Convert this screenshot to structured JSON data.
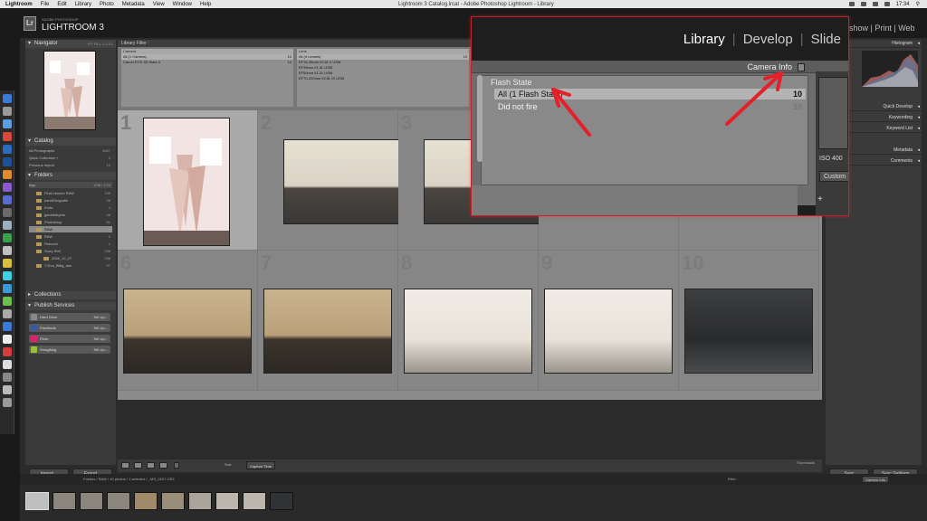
{
  "menubar": {
    "app": "Lightroom",
    "items": [
      "File",
      "Edit",
      "Library",
      "Photo",
      "Metadata",
      "View",
      "Window",
      "Help"
    ],
    "window_title": "Lightroom 3 Catalog.lrcat - Adobe Photoshop Lightroom - Library",
    "clock": "17:34"
  },
  "identity": {
    "logo": "Lr",
    "brand_small": "ADOBE PHOTOSHOP",
    "brand": "LIGHTROOM 3"
  },
  "left": {
    "navigator": {
      "title": "Navigator",
      "zooms": "FIT  FILL  1:1  4:1"
    },
    "catalog": {
      "title": "Catalog",
      "items": [
        {
          "label": "All Photographs",
          "count": "4657"
        },
        {
          "label": "Quick Collection +",
          "count": "0"
        },
        {
          "label": "Previous Import",
          "count": "10"
        }
      ]
    },
    "folders": {
      "title": "Folders",
      "volume": "bigs",
      "volume_info": "1MB / 1TB",
      "items": [
        {
          "label": "Final chosen RAW",
          "count": "135"
        },
        {
          "label": "handStorgrafie",
          "count": "26"
        },
        {
          "label": "Extra",
          "count": "4"
        },
        {
          "label": "jpeddeltryres",
          "count": "46"
        },
        {
          "label": "Photoshop",
          "count": "81"
        },
        {
          "label": "RAW",
          "count": "10"
        },
        {
          "label": "RAW",
          "count": "0"
        },
        {
          "label": "Retouch",
          "count": "1"
        },
        {
          "label": "Sorry Stef",
          "count": "236"
        },
        {
          "label": "2009_12_27",
          "count": "236"
        },
        {
          "label": "T-Dva_Billig_raw",
          "count": "97"
        }
      ]
    },
    "collections": {
      "title": "Collections"
    },
    "publish": {
      "title": "Publish Services",
      "services": [
        {
          "label": "Hard Drive",
          "action": "Set Up..."
        },
        {
          "label": "Facebook",
          "action": "Set Up..."
        },
        {
          "label": "Flickr",
          "action": "Set Up..."
        },
        {
          "label": "SmugMug",
          "action": "Set Up..."
        }
      ]
    },
    "import_btn": "Import...",
    "export_btn": "Export..."
  },
  "filterbar": {
    "title": "Library Filter :",
    "col1": {
      "head": "Camera",
      "items": [
        {
          "label": "All (1 Camera)",
          "count": "10"
        },
        {
          "label": "Canon EOS 5D Mark II",
          "count": "10"
        }
      ]
    },
    "col2": {
      "head": "Lens",
      "items": [
        {
          "label": "All (4 Lenses)",
          "count": "10"
        },
        {
          "label": "EF16-35mm f/2.8L II USM",
          "count": ""
        },
        {
          "label": "EF35mm f/1.4L USM",
          "count": ""
        },
        {
          "label": "EF50mm f/1.2L USM",
          "count": ""
        },
        {
          "label": "EF70-200mm f/2.8L IS USM",
          "count": ""
        }
      ]
    }
  },
  "grid": {
    "cells": [
      {
        "num": "1"
      },
      {
        "num": "2"
      },
      {
        "num": "3"
      },
      {
        "num": "4"
      },
      {
        "num": "5"
      },
      {
        "num": "6"
      },
      {
        "num": "7"
      },
      {
        "num": "8"
      },
      {
        "num": "9"
      },
      {
        "num": "10"
      }
    ]
  },
  "toolbar": {
    "sort_label": "Sort:",
    "sort_value": "Capture Time",
    "thumbs_label": "Thumbnails"
  },
  "right": {
    "histogram": "Histogram",
    "quick_develop": "Quick Develop",
    "keywording": "Keywording",
    "keyword_list": "Keyword List",
    "metadata": "Metadata",
    "comments": "Comments",
    "sync1": "Sync",
    "sync2": "Sync Settings"
  },
  "filmstrip": {
    "path": "Folders / RAW / 10 photos / 1 selected / _MG_0107.CR2",
    "filter_label": "Filter :",
    "filter_value": "Camera Info"
  },
  "zoom": {
    "modules": [
      "Library",
      "Develop",
      "Slide"
    ],
    "active_module": "Library",
    "filter_preset": "Camera Info",
    "column_head": "Flash State",
    "rows": [
      {
        "label": "All (1 Flash State)",
        "count": "10"
      },
      {
        "label": "Did not fire",
        "count": "10"
      }
    ],
    "iso": "ISO 400",
    "custom": "Custom",
    "plus": "+"
  },
  "outside_modules": "show | Print | Web",
  "colors": {
    "accent_red": "#c8202a",
    "folder": "#b89a57"
  }
}
